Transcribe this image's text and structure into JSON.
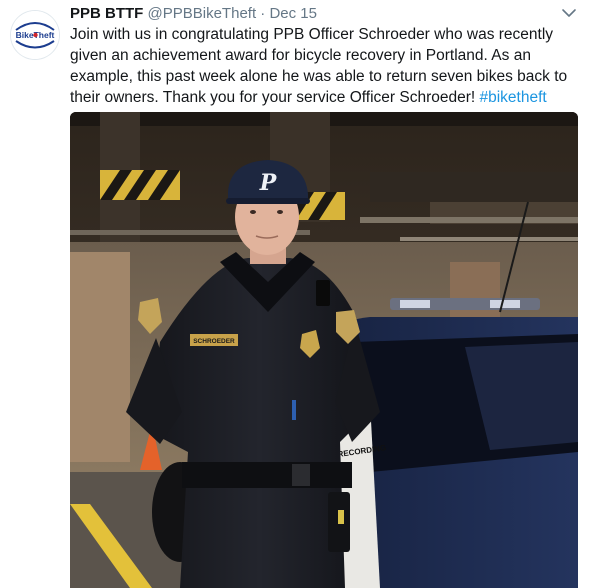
{
  "tweet": {
    "display_name": "PPB BTTF",
    "handle": "@PPBBikeTheft",
    "separator": "·",
    "timestamp": "Dec 15",
    "body": "Join with us in congratulating PPB Officer Schroeder who was recently given an achievement award for bicycle recovery in Portland. As an example, this past week alone he was able to return seven bikes back to their owners. Thank you for your service Officer Schroeder! ",
    "hashtag": "#biketheft",
    "avatar_logo_text": "BikeTheft"
  },
  "photo": {
    "cap_letter": "P",
    "car_text": "RECORDING",
    "name_tag": "SCHROEDER"
  },
  "icons": {
    "caret": "chevron-down-icon"
  },
  "colors": {
    "link": "#1b95e0",
    "secondary_text": "#657786",
    "primary_text": "#14171a"
  }
}
